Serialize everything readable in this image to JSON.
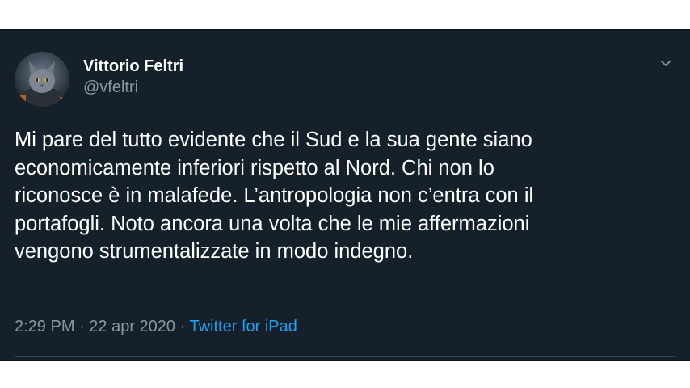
{
  "tweet": {
    "author": {
      "name": "Vittorio Feltri",
      "handle": "@vfeltri",
      "avatar_icon": "cat-avatar"
    },
    "text": "Mi pare del tutto evidente che il Sud e la sua gente siano\neconomicamente inferiori rispetto al Nord. Chi non lo\nriconosce è in malafede. L’antropologia non c’entra con il\nportafogli. Noto ancora una volta che le mie affermazioni\nvengono strumentalizzate in modo indegno.",
    "time": "2:29 PM",
    "separator": "·",
    "date": "22 apr 2020",
    "source": "Twitter for iPad",
    "menu_icon": "chevron-down-icon"
  },
  "colors": {
    "background": "#15202b",
    "text_primary": "#ffffff",
    "text_secondary": "#8899a6",
    "accent": "#1da1f2"
  }
}
